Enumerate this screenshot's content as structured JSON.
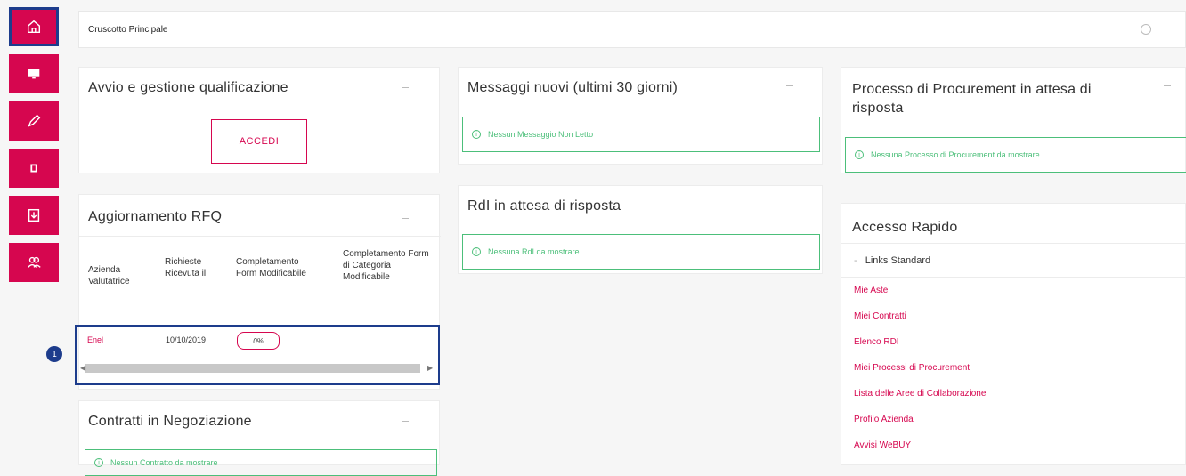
{
  "header": {
    "title": "Cruscotto Principale",
    "settings_icon": "gear-icon"
  },
  "sidebar": {
    "accent": "#d6064f",
    "items": [
      {
        "icon": "home-icon",
        "active": true
      },
      {
        "icon": "monitor-icon",
        "active": false
      },
      {
        "icon": "pencil-icon",
        "active": false
      },
      {
        "icon": "document-icon",
        "active": false
      },
      {
        "icon": "download-icon",
        "active": false
      },
      {
        "icon": "users-icon",
        "active": false
      }
    ]
  },
  "qualificazione": {
    "title": "Avvio e gestione qualificazione",
    "button": "ACCEDI"
  },
  "rfq": {
    "title": "Aggiornamento RFQ",
    "columns": [
      "Azienda Valutatrice",
      "Richieste Ricevuta il",
      "Completamento Form Modificabile",
      "Completamento Form di Categoria Modificabile"
    ],
    "row": {
      "company": "Enel",
      "date": "10/10/2019",
      "percent": "0%"
    },
    "callout": "1"
  },
  "contratti": {
    "title": "Contratti in Negoziazione",
    "empty": "Nessun Contratto da mostrare"
  },
  "messaggi": {
    "title": "Messaggi nuovi (ultimi 30 giorni)",
    "empty": "Nessun Messaggio Non Letto"
  },
  "rdi": {
    "title": "RdI in attesa di risposta",
    "empty": "Nessuna RdI da mostrare"
  },
  "procurement": {
    "title": "Processo di Procurement in attesa di risposta",
    "empty": "Nessuna Processo di Procurement da mostrare"
  },
  "accesso": {
    "title": "Accesso Rapido",
    "section": "Links Standard",
    "links": [
      "Mie Aste",
      "Miei Contratti",
      "Elenco RDI",
      "Miei Processi di Procurement",
      "Lista delle Aree di Collaborazione",
      "Profilo Azienda",
      "Avvisi WeBUY"
    ]
  }
}
